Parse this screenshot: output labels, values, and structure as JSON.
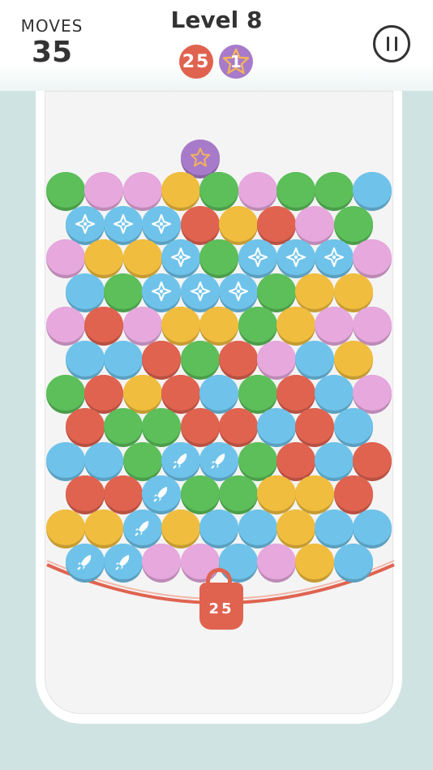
{
  "hud": {
    "moves_label": "MOVES",
    "moves_value": "35",
    "level_title": "Level 8",
    "goals": [
      {
        "type": "red-bubble",
        "count": "25"
      },
      {
        "type": "star",
        "count": "1"
      }
    ],
    "pause_icon": "pause-icon"
  },
  "colors": {
    "green": "#5cbf5a",
    "pink": "#e6a8dd",
    "yellow": "#f0bd3e",
    "blue": "#6fc3ea",
    "red": "#e06350",
    "purple": "#a77bc9",
    "background": "#cfe3e2"
  },
  "board": {
    "rows": [
      [
        "green",
        "pink",
        "pink",
        "yellow",
        "green",
        "pink",
        "green",
        "green",
        "blue"
      ],
      [
        "blue:ninja",
        "blue:ninja",
        "blue:ninja",
        "red",
        "yellow",
        "red",
        "pink",
        "green"
      ],
      [
        "pink",
        "yellow",
        "yellow",
        "blue:ninja",
        "green",
        "blue:ninja",
        "blue:ninja",
        "blue:ninja",
        "pink"
      ],
      [
        "blue",
        "green",
        "blue:ninja",
        "blue:ninja",
        "blue:ninja",
        "green",
        "yellow",
        "yellow"
      ],
      [
        "pink",
        "red",
        "pink",
        "yellow",
        "yellow",
        "green",
        "yellow",
        "pink",
        "pink"
      ],
      [
        "blue",
        "blue",
        "red",
        "green",
        "red",
        "pink",
        "blue",
        "yellow"
      ],
      [
        "green",
        "red",
        "yellow",
        "red",
        "blue",
        "green",
        "red",
        "blue",
        "pink"
      ],
      [
        "red",
        "green",
        "green",
        "red",
        "red",
        "blue",
        "red",
        "blue"
      ],
      [
        "blue",
        "blue",
        "green",
        "blue:rocket",
        "blue:rocket",
        "green",
        "red",
        "blue",
        "red"
      ],
      [
        "red",
        "red",
        "blue:rocket",
        "green",
        "green",
        "yellow",
        "yellow",
        "red"
      ],
      [
        "yellow",
        "yellow",
        "blue:rocket",
        "yellow",
        "blue",
        "blue",
        "yellow",
        "blue",
        "blue"
      ],
      [
        "blue:rocket",
        "blue:rocket",
        "pink",
        "pink",
        "blue",
        "pink",
        "yellow",
        "blue"
      ]
    ],
    "special": {
      "type": "star-bubble",
      "color": "purple",
      "icon": "star-icon"
    }
  },
  "lock": {
    "count": "25",
    "icon": "padlock-icon"
  }
}
